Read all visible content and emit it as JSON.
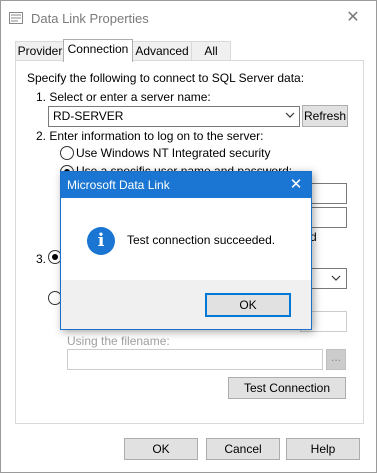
{
  "window": {
    "title": "Data Link Properties"
  },
  "tabs": [
    {
      "label": "Provider"
    },
    {
      "label": "Connection"
    },
    {
      "label": "Advanced"
    },
    {
      "label": "All"
    }
  ],
  "connection": {
    "intro": "Specify the following to connect to SQL Server data:",
    "step1_label": "1. Select or enter a server name:",
    "server_name": "RD-SERVER",
    "refresh_label": "Refresh",
    "step2_label": "2. Enter information to log on to the server:",
    "radio_windows_nt": "Use Windows NT Integrated security",
    "radio_specific_partial": "Use a specific user name and password:",
    "blank_password_partial": "d",
    "step3_label": "3.",
    "filename_label": "Using the filename:",
    "browse_label": "...",
    "test_connection_label": "Test Connection"
  },
  "footer": {
    "ok_label": "OK",
    "cancel_label": "Cancel",
    "help_label": "Help"
  },
  "dialog": {
    "title": "Microsoft Data Link",
    "message": "Test connection succeeded.",
    "ok_label": "OK",
    "icon": "info-icon"
  }
}
